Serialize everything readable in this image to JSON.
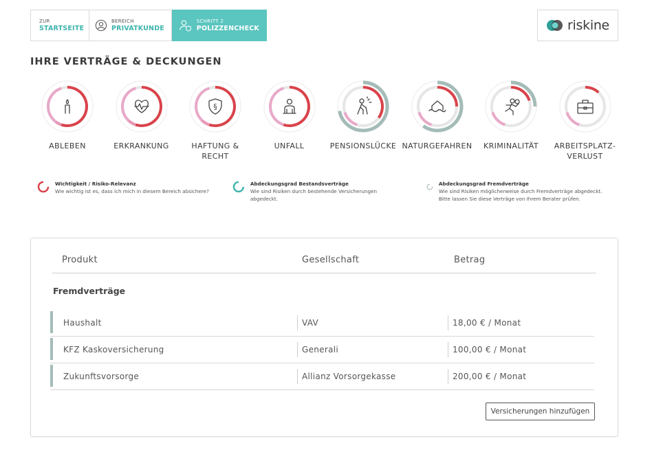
{
  "nav": {
    "step1": {
      "small": "ZUR",
      "big": "STARTSEITE"
    },
    "step2": {
      "small": "BEREICH",
      "big": "PRIVATKUNDE"
    },
    "step3": {
      "small": "SCHRITT 2",
      "big": "POLIZZENCHECK"
    }
  },
  "logo": {
    "word": "riskine",
    "icon": "riskine-logo-icon"
  },
  "section_title": "IHRE VERTRÄGE & DECKUNGEN",
  "colors": {
    "accent": "#5bc5bf",
    "importance": "#d9434b",
    "own": "#3fb4ae",
    "foreign": "#a4bcb8",
    "track": "#e6e6e6"
  },
  "categories": [
    {
      "label": "ABLEBEN",
      "icon": "candle-icon",
      "importance": 0.6,
      "own": 0,
      "foreign": 0
    },
    {
      "label": "ERKRANKUNG",
      "icon": "heart-pulse-icon",
      "importance": 0.62,
      "own": 0,
      "foreign": 0
    },
    {
      "label": "HAFTUNG & RECHT",
      "icon": "shield-paragraph-icon",
      "importance": 0.62,
      "own": 0,
      "foreign": 0
    },
    {
      "label": "UNFALL",
      "icon": "injured-person-icon",
      "importance": 0.55,
      "own": 0,
      "foreign": 0
    },
    {
      "label": "PENSIONSLÜCKE",
      "icon": "elderly-person-icon",
      "importance": 0.35,
      "own": 0,
      "foreign": 0.72
    },
    {
      "label": "NATURGEFAHREN",
      "icon": "flood-house-icon",
      "importance": 0.25,
      "own": 0,
      "foreign": 0.6
    },
    {
      "label": "KRIMINALITÄT",
      "icon": "thief-icon",
      "importance": 0.2,
      "own": 0,
      "foreign": 0.25
    },
    {
      "label": "ARBEITSPLATZ-VERLUST",
      "icon": "briefcase-icon",
      "importance": 0.12,
      "own": 0,
      "foreign": 0
    }
  ],
  "legend": [
    {
      "title": "Wichtigkeit / Risiko-Relevanz",
      "desc": "Wie wichtig ist es, dass ich mich in diesem Bereich absichere?",
      "icon": "importance-ring-icon"
    },
    {
      "title": "Abdeckungsgrad Bestandsverträge",
      "desc": "Wie sind Risiken durch bestehende Versicherungen abgedeckt.",
      "icon": "own-coverage-ring-icon"
    },
    {
      "title": "Abdeckungsgrad Fremdverträge",
      "desc": "Wie sind Risiken möglicherweise durch Fremdverträge abgedeckt. Bitte lassen Sie diese Verträge von Ihrem Berater prüfen.",
      "icon": "foreign-coverage-ring-icon"
    }
  ],
  "table": {
    "headers": {
      "product": "Produkt",
      "company": "Gesellschaft",
      "amount": "Betrag"
    },
    "group_title": "Fremdverträge",
    "rows": [
      {
        "product": "Haushalt",
        "company": "VAV",
        "amount": "18,00 € / Monat"
      },
      {
        "product": "KFZ Kaskoversicherung",
        "company": "Generali",
        "amount": "100,00 € / Monat"
      },
      {
        "product": "Zukunftsvorsorge",
        "company": "Allianz Vorsorgekasse",
        "amount": "200,00 € / Monat"
      }
    ],
    "add_button": "Versicherungen hinzufügen"
  }
}
